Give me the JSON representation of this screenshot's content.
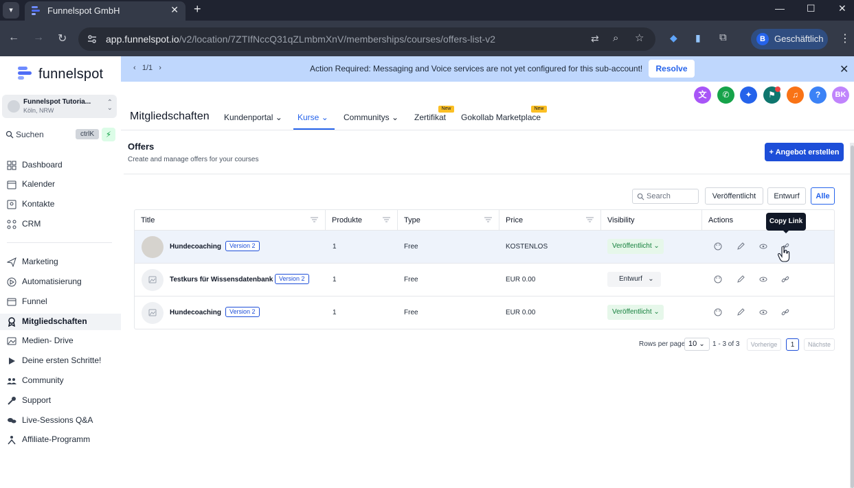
{
  "browser": {
    "tab_title": "Funnelspot GmbH",
    "url_host": "app.funnelspot.io",
    "url_path": "/v2/location/7ZTIfNccQ31qZLmbmXnV/memberships/courses/offers-list-v2",
    "profile_initial": "B",
    "profile_label": "Geschäftlich"
  },
  "sidebar": {
    "logo": "funnelspot",
    "account_name": "Funnelspot Tutoria...",
    "account_location": "Köln, NRW",
    "search_label": "Suchen",
    "search_shortcut": "ctrlK",
    "items": [
      {
        "label": "Dashboard",
        "icon": "dashboard-icon"
      },
      {
        "label": "Kalender",
        "icon": "calendar-icon"
      },
      {
        "label": "Kontakte",
        "icon": "contacts-icon"
      },
      {
        "label": "CRM",
        "icon": "crm-icon"
      },
      {
        "label": "Marketing",
        "icon": "marketing-icon"
      },
      {
        "label": "Automatisierung",
        "icon": "automation-icon"
      },
      {
        "label": "Funnel",
        "icon": "funnel-icon"
      },
      {
        "label": "Mitgliedschaften",
        "icon": "membership-icon",
        "active": true
      },
      {
        "label": "Medien- Drive",
        "icon": "media-icon"
      },
      {
        "label": "Deine ersten Schritte!",
        "icon": "play-icon"
      },
      {
        "label": "Community",
        "icon": "community-icon"
      },
      {
        "label": "Support",
        "icon": "wrench-icon"
      },
      {
        "label": "Live-Sessions Q&A",
        "icon": "chat-icon"
      },
      {
        "label": "Affiliate-Programm",
        "icon": "affiliate-icon"
      }
    ]
  },
  "banner": {
    "pager": "1/1",
    "text": "Action Required: Messaging and Voice services are not yet configured for this sub-account!",
    "resolve_label": "Resolve"
  },
  "header": {
    "title": "Mitgliedschaften",
    "nav": [
      {
        "label": "Kundenportal",
        "dropdown": true
      },
      {
        "label": "Kurse",
        "dropdown": true,
        "active": true
      },
      {
        "label": "Communitys",
        "dropdown": true
      },
      {
        "label": "Zertifikat",
        "badge": "New"
      },
      {
        "label": "Gokollab Marketplace",
        "badge": "New"
      }
    ],
    "user_initials": "BK"
  },
  "offers": {
    "title": "Offers",
    "subtitle": "Create and manage offers for your courses",
    "create_label": "+ Angebot erstellen",
    "search_placeholder": "Search",
    "filters": [
      "Veröffentlicht",
      "Entwurf",
      "Alle"
    ],
    "active_filter": "Alle",
    "columns": [
      "Title",
      "Produkte",
      "Type",
      "Price",
      "Visibility",
      "Actions"
    ],
    "rows": [
      {
        "title": "Hundecoaching",
        "version": "Version 2",
        "products": "1",
        "type": "Free",
        "price": "KOSTENLOS",
        "visibility": "Veröffentlicht"
      },
      {
        "title": "Testkurs für Wissensdatenbank",
        "version": "Version 2",
        "products": "1",
        "type": "Free",
        "price": "EUR 0.00",
        "visibility": "Entwurf"
      },
      {
        "title": "Hundecoaching",
        "version": "Version 2",
        "products": "1",
        "type": "Free",
        "price": "EUR 0.00",
        "visibility": "Veröffentlicht"
      }
    ],
    "tooltip": "Copy Link",
    "pagination": {
      "rows_per_page_label": "Rows per page",
      "rows_per_page": "10",
      "range": "1 - 3 of 3",
      "prev_label": "Vorherige",
      "next_label": "Nächste",
      "current_page": "1"
    }
  },
  "colors": {
    "accent": "#2563eb",
    "banner_bg": "#bfd7fd",
    "published": "#15803d"
  }
}
